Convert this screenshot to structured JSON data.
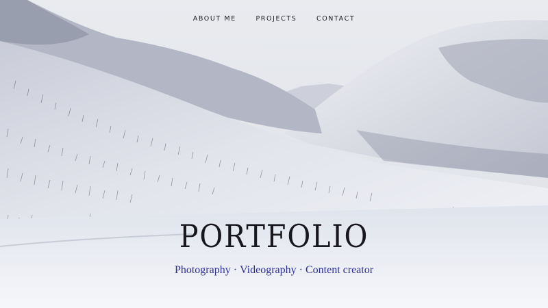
{
  "nav": {
    "items": [
      "ABOUT ME",
      "PROJECTS",
      "CONTACT"
    ]
  },
  "hero": {
    "title": "PORTFOLIO",
    "tags": [
      "Photography",
      "Videography",
      "Content creator"
    ],
    "separator": "·"
  },
  "colors": {
    "subtitle": "#2b2f8f",
    "title": "#17171d",
    "nav_text": "#1c1c22"
  }
}
